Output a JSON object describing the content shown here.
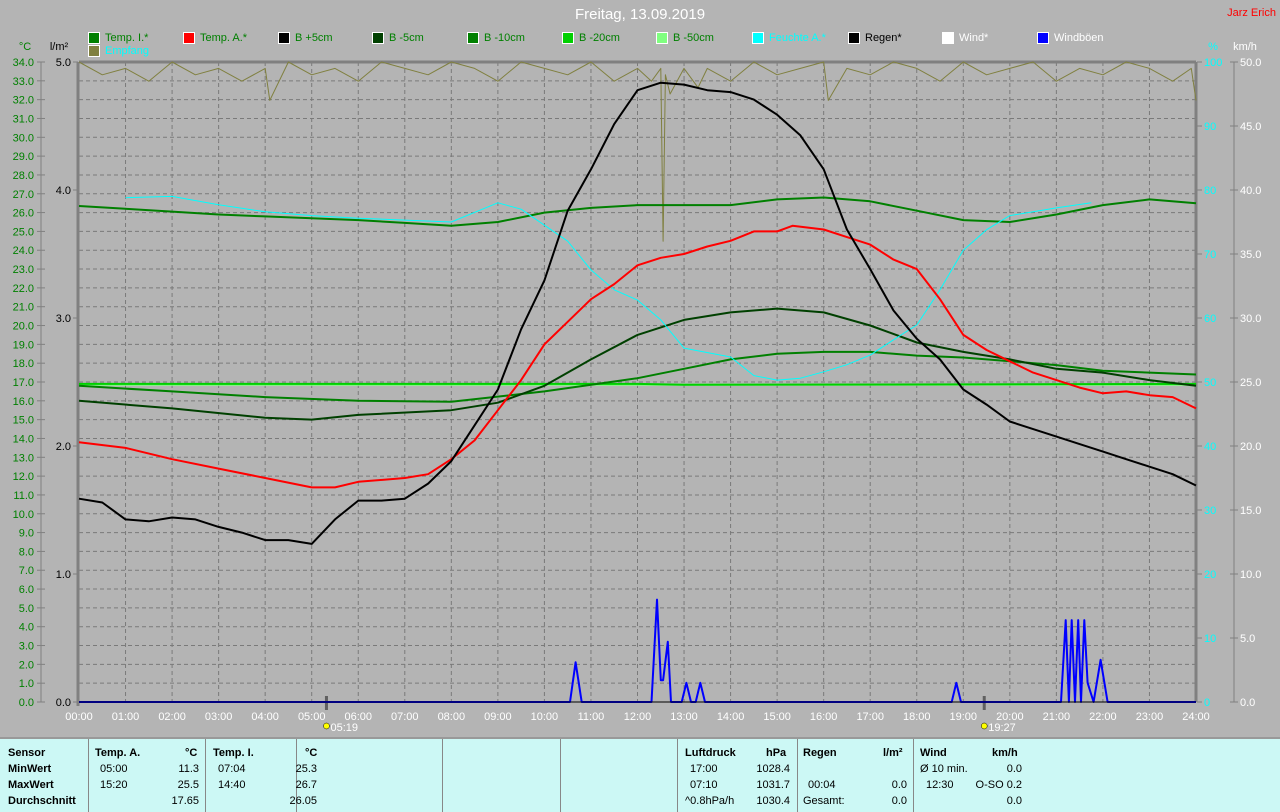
{
  "header": {
    "title": "Freitag, 13.09.2019",
    "author": "Jarz Erich"
  },
  "legend": [
    {
      "label": "Temp. I.*",
      "color": "#008000",
      "text_color": "#008000"
    },
    {
      "label": "Temp. A.*",
      "color": "#ff0000",
      "text_color": "#008000"
    },
    {
      "label": "B +5cm",
      "color": "#000000",
      "text_color": "#008000"
    },
    {
      "label": "B -5cm",
      "color": "#004000",
      "text_color": "#008000"
    },
    {
      "label": "B -10cm",
      "color": "#008000",
      "text_color": "#008000"
    },
    {
      "label": "B -20cm",
      "color": "#00d000",
      "text_color": "#008000"
    },
    {
      "label": "B -50cm",
      "color": "#80ff80",
      "text_color": "#008000"
    },
    {
      "label": "Feuchte A.*",
      "color": "#00ffff",
      "text_color": "#00ffff"
    },
    {
      "label": "Regen*",
      "color": "#000000",
      "text_color": "#000000"
    },
    {
      "label": "Wind*",
      "color": "#ffffff",
      "text_color": "#ffffff"
    },
    {
      "label": "Windböen",
      "color": "#0000ff",
      "text_color": "#ffffff"
    },
    {
      "label": "Empfang",
      "color": "#808040",
      "text_color": "#00ffff"
    }
  ],
  "chart_data": {
    "type": "line",
    "title": "Freitag, 13.09.2019",
    "xlabel": "",
    "x_ticks": [
      "00:00",
      "01:00",
      "02:00",
      "03:00",
      "04:00",
      "05:00",
      "06:00",
      "07:00",
      "08:00",
      "09:00",
      "10:00",
      "11:00",
      "12:00",
      "13:00",
      "14:00",
      "15:00",
      "16:00",
      "17:00",
      "18:00",
      "19:00",
      "20:00",
      "21:00",
      "22:00",
      "23:00",
      "24:00"
    ],
    "xlim_hours": [
      0,
      24
    ],
    "axes": {
      "temp": {
        "unit": "°C",
        "range": [
          0,
          34
        ],
        "ticks": [
          "0.0",
          "1.0",
          "2.0",
          "3.0",
          "4.0",
          "5.0",
          "6.0",
          "7.0",
          "8.0",
          "9.0",
          "10.0",
          "11.0",
          "12.0",
          "13.0",
          "14.0",
          "15.0",
          "16.0",
          "17.0",
          "18.0",
          "19.0",
          "20.0",
          "21.0",
          "22.0",
          "23.0",
          "24.0",
          "25.0",
          "26.0",
          "27.0",
          "28.0",
          "29.0",
          "30.0",
          "31.0",
          "32.0",
          "33.0",
          "34.0"
        ]
      },
      "rain": {
        "unit": "l/m²",
        "range": [
          0,
          5
        ],
        "ticks": [
          "0.0",
          "1.0",
          "2.0",
          "3.0",
          "4.0",
          "5.0"
        ]
      },
      "humidity": {
        "unit": "%",
        "range": [
          0,
          100
        ],
        "ticks": [
          "0",
          "10",
          "20",
          "30",
          "40",
          "50",
          "60",
          "70",
          "80",
          "90",
          "100"
        ]
      },
      "wind": {
        "unit": "km/h",
        "range": [
          0,
          50
        ],
        "ticks": [
          "0.0",
          "5.0",
          "10.0",
          "15.0",
          "20.0",
          "25.0",
          "30.0",
          "35.0",
          "40.0",
          "45.0",
          "50.0"
        ]
      }
    },
    "grid": true,
    "markers": [
      {
        "label": "05:19",
        "hour": 5.317,
        "type": "sunrise"
      },
      {
        "label": "19:27",
        "hour": 19.45,
        "type": "sunset"
      }
    ],
    "series": [
      {
        "name": "Empfang",
        "axis": "humidity",
        "color": "#808040",
        "x": [
          0,
          0.5,
          1,
          1.5,
          2,
          2.5,
          3,
          3.5,
          4,
          4.1,
          4.5,
          5,
          5.5,
          6,
          6.5,
          7,
          7.5,
          8,
          8.5,
          9,
          9.5,
          10,
          10.5,
          11,
          11.5,
          12,
          12.3,
          12.5,
          12.55,
          12.6,
          12.7,
          13,
          13.3,
          13.5,
          14,
          14.5,
          15,
          15.5,
          16,
          16.1,
          16.5,
          17,
          17.5,
          18,
          18.5,
          19,
          19.5,
          20,
          20.5,
          21,
          21.5,
          22,
          22.5,
          23,
          23.5,
          23.9,
          24
        ],
        "y": [
          100,
          98,
          99,
          97,
          100,
          98,
          99,
          97,
          99,
          94,
          100,
          98,
          99,
          97,
          100,
          99,
          98,
          100,
          99,
          97,
          100,
          99,
          98,
          100,
          97,
          99,
          97,
          99,
          72,
          98,
          95,
          99,
          96,
          99,
          97,
          100,
          98,
          99,
          100,
          94,
          99,
          98,
          100,
          99,
          97,
          100,
          98,
          99,
          100,
          97,
          99,
          98,
          100,
          99,
          97,
          99,
          94
        ]
      },
      {
        "name": "Temp. I.",
        "axis": "temp",
        "color": "#008000",
        "x": [
          0,
          1,
          2,
          3,
          4,
          5,
          6,
          7,
          8,
          9,
          10,
          11,
          12,
          13,
          14,
          15,
          16,
          17,
          18,
          19,
          20,
          21,
          22,
          23,
          24
        ],
        "y": [
          26.35,
          26.2,
          26.05,
          25.9,
          25.8,
          25.7,
          25.6,
          25.45,
          25.3,
          25.5,
          26.0,
          26.25,
          26.4,
          26.4,
          26.4,
          26.7,
          26.8,
          26.6,
          26.1,
          25.6,
          25.5,
          25.9,
          26.4,
          26.7,
          26.5
        ]
      },
      {
        "name": "B -50cm",
        "axis": "temp",
        "color": "#80ff80",
        "x": [
          0,
          24
        ],
        "y": [
          16.85,
          16.85
        ]
      },
      {
        "name": "B -20cm",
        "axis": "temp",
        "color": "#00d000",
        "x": [
          0,
          12,
          13,
          24
        ],
        "y": [
          16.9,
          16.9,
          16.85,
          16.9
        ]
      },
      {
        "name": "B -10cm",
        "axis": "temp",
        "color": "#008000",
        "x": [
          0,
          2,
          4,
          6,
          8,
          10,
          12,
          13,
          14,
          15,
          16,
          17,
          18,
          19,
          20,
          21,
          22,
          23,
          24
        ],
        "y": [
          16.8,
          16.5,
          16.2,
          16.0,
          15.95,
          16.5,
          17.2,
          17.7,
          18.2,
          18.5,
          18.6,
          18.6,
          18.4,
          18.3,
          18.1,
          17.9,
          17.6,
          17.5,
          17.4
        ]
      },
      {
        "name": "B -5cm",
        "axis": "temp",
        "color": "#004000",
        "x": [
          0,
          2,
          4,
          5,
          6,
          8,
          9,
          10,
          11,
          12,
          13,
          14,
          15,
          16,
          17,
          18,
          19,
          20,
          21,
          22,
          23,
          24
        ],
        "y": [
          16.0,
          15.6,
          15.1,
          15.0,
          15.25,
          15.5,
          15.9,
          16.8,
          18.2,
          19.5,
          20.3,
          20.7,
          20.9,
          20.7,
          20.0,
          19.1,
          18.6,
          18.2,
          17.7,
          17.5,
          17.1,
          16.8
        ]
      },
      {
        "name": "Feuchte A.",
        "axis": "humidity",
        "color": "#00ffff",
        "x": [
          1,
          2,
          3,
          4,
          5,
          6,
          7,
          8,
          9,
          9.5,
          10,
          10.5,
          11,
          11.5,
          12,
          12.5,
          13,
          14,
          14.5,
          15,
          15.5,
          16,
          16.5,
          17,
          17.5,
          18,
          18.5,
          19,
          19.5,
          20,
          21,
          21.75
        ],
        "y": [
          78.8,
          79,
          77.7,
          76.6,
          76,
          75.6,
          75.3,
          75,
          78,
          77,
          74.5,
          72,
          67.5,
          64.4,
          62.8,
          59.7,
          55.3,
          53.9,
          51,
          50.3,
          50.6,
          51.6,
          52.7,
          54.2,
          56.6,
          58.9,
          64.4,
          70.6,
          73.8,
          76,
          77.2,
          78
        ]
      },
      {
        "name": "Temp. A.",
        "axis": "temp",
        "color": "#ff0000",
        "x": [
          0,
          1,
          2,
          3,
          4,
          5,
          5.5,
          6,
          7,
          7.5,
          8,
          8.5,
          9,
          9.5,
          10,
          10.5,
          11,
          11.5,
          12,
          12.5,
          13,
          13.5,
          14,
          14.5,
          15,
          15.33,
          16,
          16.5,
          17,
          17.5,
          18,
          18.5,
          19,
          19.5,
          20,
          20.5,
          21,
          21.5,
          22,
          22.5,
          23,
          23.5,
          24
        ],
        "y": [
          13.8,
          13.5,
          12.9,
          12.4,
          11.9,
          11.4,
          11.4,
          11.7,
          11.9,
          12.1,
          12.9,
          13.9,
          15.5,
          17.1,
          19.0,
          20.2,
          21.4,
          22.2,
          23.2,
          23.6,
          23.8,
          24.2,
          24.5,
          25.0,
          25.0,
          25.3,
          25.1,
          24.7,
          24.3,
          23.5,
          23.0,
          21.4,
          19.5,
          18.7,
          18.1,
          17.5,
          17.1,
          16.7,
          16.4,
          16.5,
          16.3,
          16.2,
          15.6
        ]
      },
      {
        "name": "B +5cm",
        "axis": "temp",
        "color": "#000000",
        "x": [
          0,
          0.5,
          1,
          1.5,
          2,
          2.5,
          3,
          3.5,
          4,
          4.5,
          5,
          5.5,
          6,
          6.5,
          7,
          7.5,
          8,
          8.5,
          9,
          9.5,
          10,
          10.5,
          11,
          11.5,
          12,
          12.5,
          13,
          13.5,
          14,
          14.5,
          15,
          15.5,
          16,
          16.5,
          17,
          17.5,
          18,
          18.5,
          19,
          19.5,
          20,
          20.5,
          21,
          21.5,
          22,
          22.5,
          23,
          23.5,
          24
        ],
        "y": [
          10.8,
          10.6,
          9.7,
          9.6,
          9.8,
          9.7,
          9.3,
          9.0,
          8.6,
          8.6,
          8.4,
          9.7,
          10.7,
          10.7,
          10.8,
          11.6,
          12.8,
          14.7,
          16.6,
          19.8,
          22.4,
          26.1,
          28.3,
          30.7,
          32.5,
          32.9,
          32.8,
          32.5,
          32.4,
          32.0,
          31.2,
          30.1,
          28.3,
          25.1,
          23.0,
          20.8,
          19.3,
          18.2,
          16.6,
          15.8,
          14.9,
          14.5,
          14.1,
          13.7,
          13.3,
          12.9,
          12.5,
          12.1,
          11.5
        ]
      },
      {
        "name": "Windböen",
        "axis": "wind",
        "color": "#0000ff",
        "x": [
          0,
          10.55,
          10.67,
          10.8,
          12.3,
          12.42,
          12.5,
          12.55,
          12.65,
          12.72,
          12.8,
          12.95,
          13.05,
          13.15,
          13.25,
          13.35,
          13.45,
          18.75,
          18.85,
          18.95,
          21.1,
          21.2,
          21.27,
          21.33,
          21.4,
          21.47,
          21.53,
          21.6,
          21.67,
          21.8,
          21.95,
          22.1,
          24
        ],
        "y": [
          0,
          0,
          3.1,
          0,
          0,
          8.0,
          1.7,
          1.7,
          4.7,
          0,
          0,
          0,
          1.5,
          0,
          0,
          1.5,
          0,
          0,
          1.5,
          0,
          0,
          6.4,
          0,
          6.4,
          0,
          6.4,
          0,
          6.4,
          1.5,
          0,
          3.3,
          0,
          0
        ]
      },
      {
        "name": "Regen",
        "axis": "rain",
        "color": "#000000",
        "x": [
          0,
          24
        ],
        "y": [
          0,
          0
        ]
      }
    ]
  },
  "table": {
    "sensor": {
      "header": "Sensor",
      "rows": [
        "MinWert",
        "MaxWert",
        "Durchschnitt"
      ]
    },
    "temp_a": {
      "header": "Temp. A.",
      "unit": "°C",
      "min_time": "05:00",
      "min": "11.3",
      "max_time": "15:20",
      "max": "25.5",
      "avg": "17.65"
    },
    "temp_i": {
      "header": "Temp. I.",
      "unit": "°C",
      "min_time": "07:04",
      "min": "25.3",
      "max_time": "14:40",
      "max": "26.7",
      "avg": "26.05"
    },
    "pressure": {
      "header": "Luftdruck",
      "unit": "hPa",
      "r1_label": "17:00",
      "r1": "1028.4",
      "r2_label": "07:10",
      "r2": "1031.7",
      "r3_label": "^0.8hPa/h",
      "r3": "1030.4"
    },
    "rain": {
      "header": "Regen",
      "unit": "l/m²",
      "r2_label": "00:04",
      "r2": "0.0",
      "r3_label": "Gesamt:",
      "r3": "0.0"
    },
    "wind": {
      "header": "Wind",
      "unit": "km/h",
      "r1_label": "Ø 10 min.",
      "r1": "0.0",
      "r2_label": "12:30",
      "r2": "O-SO 0.2",
      "r3": "0.0"
    }
  }
}
